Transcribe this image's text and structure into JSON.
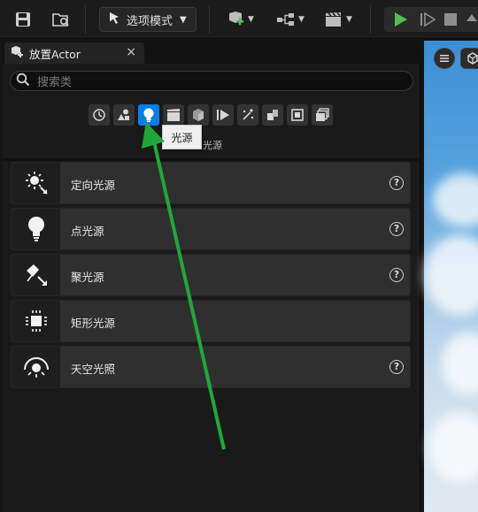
{
  "toolbar": {
    "mode_label": "选项模式"
  },
  "panel": {
    "tab_title": "放置Actor",
    "close_glyph": "×",
    "search_placeholder": "搜索类",
    "filters": [
      {
        "name": "recent-icon"
      },
      {
        "name": "basic-icon"
      },
      {
        "name": "light-bulb-icon"
      },
      {
        "name": "cinematic-icon"
      },
      {
        "name": "visual-effects-icon"
      },
      {
        "name": "volumes-icon"
      },
      {
        "name": "particles-icon"
      },
      {
        "name": "geometry-icon"
      },
      {
        "name": "all-classes-icon"
      },
      {
        "name": "layers-icon"
      }
    ],
    "active_filter_caption": "光源",
    "tooltip": "光源",
    "items": [
      {
        "label": "定向光源",
        "icon": "directional-light-icon",
        "help": "?"
      },
      {
        "label": "点光源",
        "icon": "point-light-icon",
        "help": "?"
      },
      {
        "label": "聚光源",
        "icon": "spot-light-icon",
        "help": "?"
      },
      {
        "label": "矩形光源",
        "icon": "rect-light-icon"
      },
      {
        "label": "天空光照",
        "icon": "sky-light-icon",
        "help": "?"
      }
    ]
  },
  "colors": {
    "accent": "#0a7ee8",
    "play": "#4fc04f",
    "annotation_arrow": "#1fa83a"
  }
}
